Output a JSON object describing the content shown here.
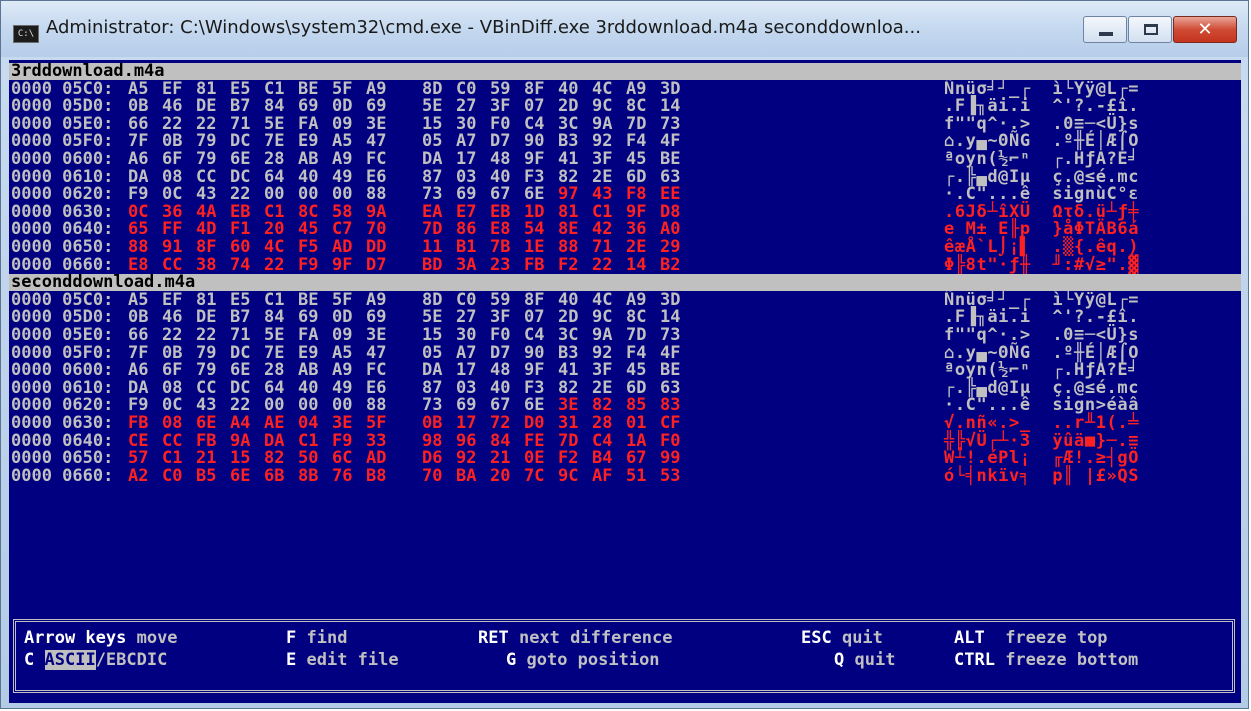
{
  "window": {
    "title": "Administrator: C:\\Windows\\system32\\cmd.exe - VBinDiff.exe  3rddownload.m4a seconddownloa...",
    "icon_text": "C:\\",
    "close_glyph": "✕"
  },
  "panes": [
    {
      "filename": "3rddownload.m4a",
      "rows": [
        {
          "addr": "0000 05C0:",
          "hex": [
            "A5",
            "EF",
            "81",
            "E5",
            "C1",
            "BE",
            "5F",
            "A9",
            "8D",
            "C0",
            "59",
            "8F",
            "40",
            "4C",
            "A9",
            "3D"
          ],
          "diff": [],
          "ascii": "Ñnüσ╛┘_┌  ì└Yÿ@L┌="
        },
        {
          "addr": "0000 05D0:",
          "hex": [
            "0B",
            "46",
            "DE",
            "B7",
            "84",
            "69",
            "0D",
            "69",
            "5E",
            "27",
            "3F",
            "07",
            "2D",
            "9C",
            "8C",
            "14"
          ],
          "diff": [],
          "ascii": ".F▐╖äi.i  ^'?.-£î."
        },
        {
          "addr": "0000 05E0:",
          "hex": [
            "66",
            "22",
            "22",
            "71",
            "5E",
            "FA",
            "09",
            "3E",
            "15",
            "30",
            "F0",
            "C4",
            "3C",
            "9A",
            "7D",
            "73"
          ],
          "diff": [],
          "ascii": "f\"\"q^·.>  .0≡─<Ü}s"
        },
        {
          "addr": "0000 05F0:",
          "hex": [
            "7F",
            "0B",
            "79",
            "DC",
            "7E",
            "E9",
            "A5",
            "47",
            "05",
            "A7",
            "D7",
            "90",
            "B3",
            "92",
            "F4",
            "4F"
          ],
          "diff": [],
          "ascii": "⌂.y▄~ΘÑG  .º╫É│Æ⌠O"
        },
        {
          "addr": "0000 0600:",
          "hex": [
            "A6",
            "6F",
            "79",
            "6E",
            "28",
            "AB",
            "A9",
            "FC",
            "DA",
            "17",
            "48",
            "9F",
            "41",
            "3F",
            "45",
            "BE"
          ],
          "diff": [],
          "ascii": "ªoyn(½⌐ⁿ  ┌.HƒA?E╛"
        },
        {
          "addr": "0000 0610:",
          "hex": [
            "DA",
            "08",
            "CC",
            "DC",
            "64",
            "40",
            "49",
            "E6",
            "87",
            "03",
            "40",
            "F3",
            "82",
            "2E",
            "6D",
            "63"
          ],
          "diff": [],
          "ascii": "┌.╠▄d@Iµ  ç.@≤é.mc"
        },
        {
          "addr": "0000 0620:",
          "hex": [
            "F9",
            "0C",
            "43",
            "22",
            "00",
            "00",
            "00",
            "88",
            "73",
            "69",
            "67",
            "6E",
            "97",
            "43",
            "F8",
            "EE"
          ],
          "diff": [
            12,
            13,
            14,
            15
          ],
          "ascii": "·.C\"...ê  signùC°ε"
        },
        {
          "addr": "0000 0630:",
          "hex": [
            "0C",
            "36",
            "4A",
            "EB",
            "C1",
            "8C",
            "58",
            "9A",
            "EA",
            "E7",
            "EB",
            "1D",
            "81",
            "C1",
            "9F",
            "D8"
          ],
          "diff": [
            0,
            1,
            2,
            3,
            4,
            5,
            6,
            7,
            8,
            9,
            10,
            11,
            12,
            13,
            14,
            15
          ],
          "ascii": ".6Jδ┴îXÜ  Ωτδ.ü┴ƒ╪"
        },
        {
          "addr": "0000 0640:",
          "hex": [
            "65",
            "FF",
            "4D",
            "F1",
            "20",
            "45",
            "C7",
            "70",
            "7D",
            "86",
            "E8",
            "54",
            "8E",
            "42",
            "36",
            "A0"
          ],
          "diff": [
            0,
            1,
            2,
            3,
            4,
            5,
            6,
            7,
            8,
            9,
            10,
            11,
            12,
            13,
            14,
            15
          ],
          "ascii": "e M± E╟p  }åΦTÄB6á"
        },
        {
          "addr": "0000 0650:",
          "hex": [
            "88",
            "91",
            "8F",
            "60",
            "4C",
            "F5",
            "AD",
            "DD",
            "11",
            "B1",
            "7B",
            "1E",
            "88",
            "71",
            "2E",
            "29"
          ],
          "diff": [
            0,
            1,
            2,
            3,
            4,
            5,
            6,
            7,
            8,
            9,
            10,
            11,
            12,
            13,
            14,
            15
          ],
          "ascii": "êæÅ`L⌡¡▌  .▒{.êq.)"
        },
        {
          "addr": "0000 0660:",
          "hex": [
            "E8",
            "CC",
            "38",
            "74",
            "22",
            "F9",
            "9F",
            "D7",
            "BD",
            "3A",
            "23",
            "FB",
            "F2",
            "22",
            "14",
            "B2"
          ],
          "diff": [
            0,
            1,
            2,
            3,
            4,
            5,
            6,
            7,
            8,
            9,
            10,
            11,
            12,
            13,
            14,
            15
          ],
          "ascii": "Φ╠8t\"·ƒ╫  ╜:#√≥\".▓"
        }
      ]
    },
    {
      "filename": "seconddownload.m4a",
      "rows": [
        {
          "addr": "0000 05C0:",
          "hex": [
            "A5",
            "EF",
            "81",
            "E5",
            "C1",
            "BE",
            "5F",
            "A9",
            "8D",
            "C0",
            "59",
            "8F",
            "40",
            "4C",
            "A9",
            "3D"
          ],
          "diff": [],
          "ascii": "Ñnüσ╛┘_┌  ì└Yÿ@L┌="
        },
        {
          "addr": "0000 05D0:",
          "hex": [
            "0B",
            "46",
            "DE",
            "B7",
            "84",
            "69",
            "0D",
            "69",
            "5E",
            "27",
            "3F",
            "07",
            "2D",
            "9C",
            "8C",
            "14"
          ],
          "diff": [],
          "ascii": ".F▐╖äi.i  ^'?.-£î."
        },
        {
          "addr": "0000 05E0:",
          "hex": [
            "66",
            "22",
            "22",
            "71",
            "5E",
            "FA",
            "09",
            "3E",
            "15",
            "30",
            "F0",
            "C4",
            "3C",
            "9A",
            "7D",
            "73"
          ],
          "diff": [],
          "ascii": "f\"\"q^·.>  .0≡─<Ü}s"
        },
        {
          "addr": "0000 05F0:",
          "hex": [
            "7F",
            "0B",
            "79",
            "DC",
            "7E",
            "E9",
            "A5",
            "47",
            "05",
            "A7",
            "D7",
            "90",
            "B3",
            "92",
            "F4",
            "4F"
          ],
          "diff": [],
          "ascii": "⌂.y▄~ΘÑG  .º╫É│Æ⌠O"
        },
        {
          "addr": "0000 0600:",
          "hex": [
            "A6",
            "6F",
            "79",
            "6E",
            "28",
            "AB",
            "A9",
            "FC",
            "DA",
            "17",
            "48",
            "9F",
            "41",
            "3F",
            "45",
            "BE"
          ],
          "diff": [],
          "ascii": "ªoyn(½⌐ⁿ  ┌.HƒA?E╛"
        },
        {
          "addr": "0000 0610:",
          "hex": [
            "DA",
            "08",
            "CC",
            "DC",
            "64",
            "40",
            "49",
            "E6",
            "87",
            "03",
            "40",
            "F3",
            "82",
            "2E",
            "6D",
            "63"
          ],
          "diff": [],
          "ascii": "┌.╠▄d@Iµ  ç.@≤é.mc"
        },
        {
          "addr": "0000 0620:",
          "hex": [
            "F9",
            "0C",
            "43",
            "22",
            "00",
            "00",
            "00",
            "88",
            "73",
            "69",
            "67",
            "6E",
            "3E",
            "82",
            "85",
            "83"
          ],
          "diff": [
            12,
            13,
            14,
            15
          ],
          "ascii": "·.C\"...ê  sign>éàâ"
        },
        {
          "addr": "0000 0630:",
          "hex": [
            "FB",
            "08",
            "6E",
            "A4",
            "AE",
            "04",
            "3E",
            "5F",
            "0B",
            "17",
            "72",
            "D0",
            "31",
            "28",
            "01",
            "CF"
          ],
          "diff": [
            0,
            1,
            2,
            3,
            4,
            5,
            6,
            7,
            8,
            9,
            10,
            11,
            12,
            13,
            14,
            15
          ],
          "ascii": "√.nñ«.>_  ..r╨1(.╧"
        },
        {
          "addr": "0000 0640:",
          "hex": [
            "CE",
            "CC",
            "FB",
            "9A",
            "DA",
            "C1",
            "F9",
            "33",
            "98",
            "96",
            "84",
            "FE",
            "7D",
            "C4",
            "1A",
            "F0"
          ],
          "diff": [
            0,
            1,
            2,
            3,
            4,
            5,
            6,
            7,
            8,
            9,
            10,
            11,
            12,
            13,
            14,
            15
          ],
          "ascii": "╬╠√Ü┌┴·3  ÿûä■}─.≡"
        },
        {
          "addr": "0000 0650:",
          "hex": [
            "57",
            "C1",
            "21",
            "15",
            "82",
            "50",
            "6C",
            "AD",
            "D6",
            "92",
            "21",
            "0E",
            "F2",
            "B4",
            "67",
            "99"
          ],
          "diff": [
            0,
            1,
            2,
            3,
            4,
            5,
            6,
            7,
            8,
            9,
            10,
            11,
            12,
            13,
            14,
            15
          ],
          "ascii": "W┴!.éPl¡  ╓Æ!.≥┤gÖ"
        },
        {
          "addr": "0000 0660:",
          "hex": [
            "A2",
            "C0",
            "B5",
            "6E",
            "6B",
            "8B",
            "76",
            "B8",
            "70",
            "BA",
            "20",
            "7C",
            "9C",
            "AF",
            "51",
            "53"
          ],
          "diff": [
            0,
            1,
            2,
            3,
            4,
            5,
            6,
            7,
            8,
            9,
            10,
            11,
            12,
            13,
            14,
            15
          ],
          "ascii": "ó└╡nkïv╕  p║ |£»QS"
        }
      ]
    }
  ],
  "help": {
    "line1": [
      {
        "key": "Arrow keys",
        "text": " move"
      },
      {
        "key": "F",
        "text": " find"
      },
      {
        "key": "RET",
        "text": " next difference"
      },
      {
        "key": "ESC",
        "text": " quit"
      },
      {
        "key": "ALT",
        "text": "  freeze top"
      }
    ],
    "line2": [
      {
        "key": "C",
        "text": ""
      },
      {
        "key": "E",
        "text": " edit file"
      },
      {
        "key": "G",
        "text": " goto position"
      },
      {
        "key": "Q",
        "text": " quit"
      },
      {
        "key": "CTRL",
        "text": " freeze bottom"
      }
    ],
    "ascii_label": "ASCII",
    "ebcdic_label": "/EBCDIC"
  },
  "colors": {
    "console_bg": "#000080",
    "text": "#c0c0c0",
    "diff": "#ff2020",
    "header_bg": "#c0c0c0"
  }
}
